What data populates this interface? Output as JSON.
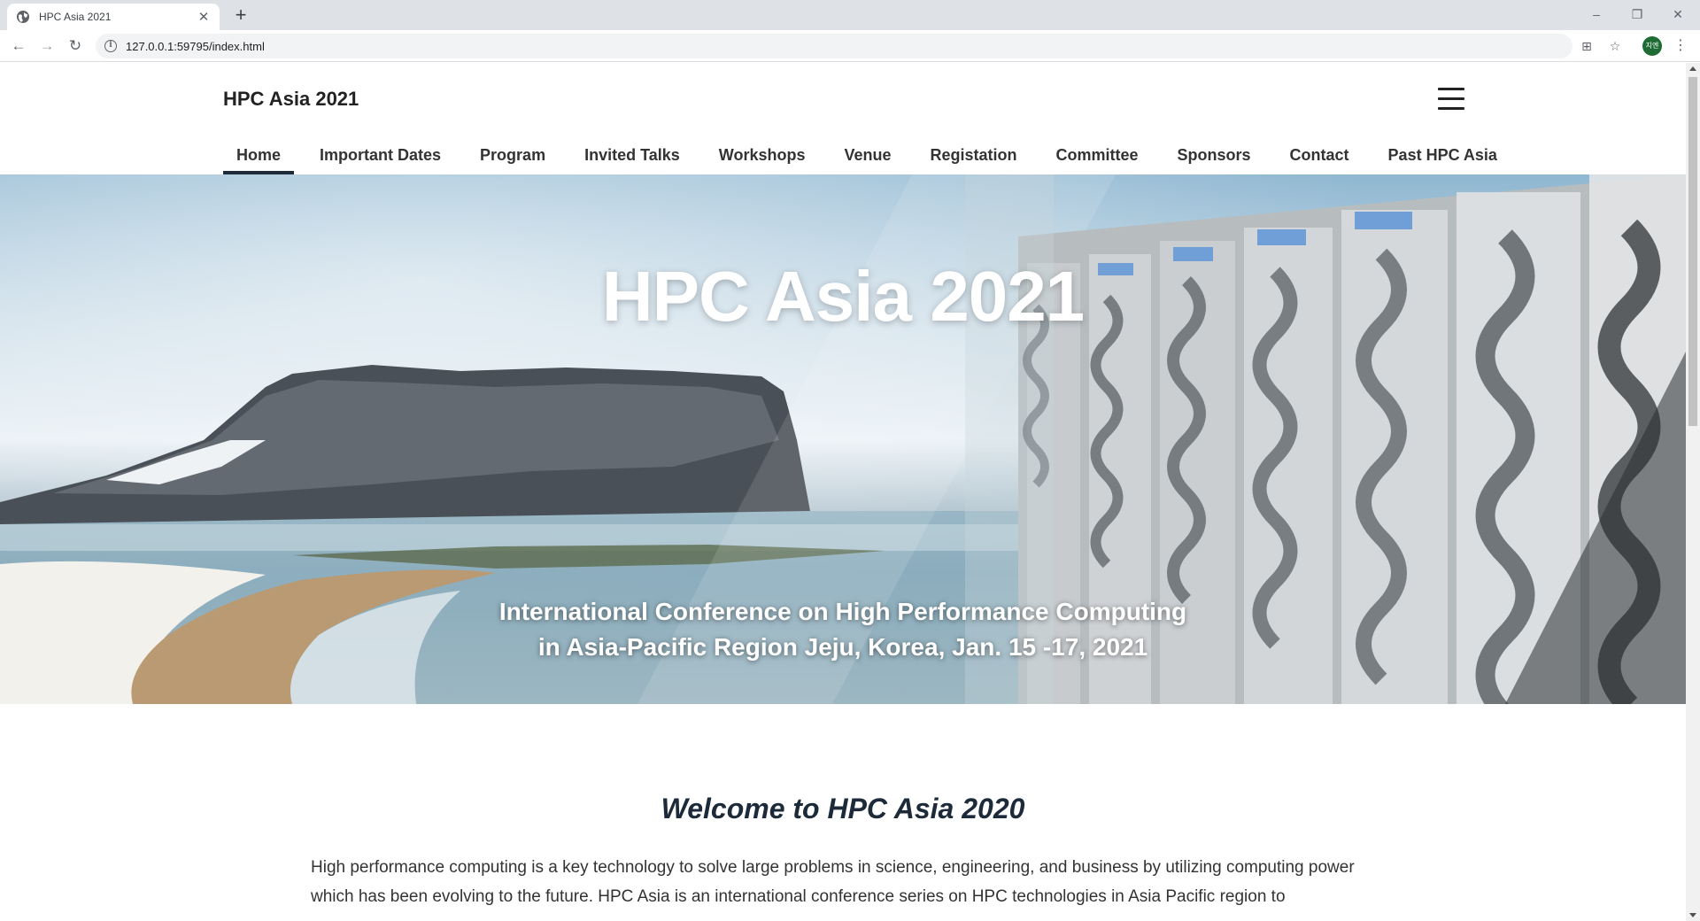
{
  "browser": {
    "tab_title": "HPC Asia 2021",
    "url": "127.0.0.1:59795/index.html",
    "avatar_text": "지엔"
  },
  "site": {
    "brand": "HPC Asia 2021",
    "nav": [
      {
        "label": "Home",
        "active": true
      },
      {
        "label": "Important Dates"
      },
      {
        "label": "Program"
      },
      {
        "label": "Invited Talks"
      },
      {
        "label": "Workshops"
      },
      {
        "label": "Venue"
      },
      {
        "label": "Registation"
      },
      {
        "label": "Committee"
      },
      {
        "label": "Sponsors"
      },
      {
        "label": "Contact"
      },
      {
        "label": "Past HPC Asia"
      }
    ]
  },
  "hero": {
    "title": "HPC Asia 2021",
    "subtitle_line1": "International Conference on High Performance Computing",
    "subtitle_line2": "in Asia-Pacific Region Jeju, Korea, Jan. 15 -17, 2021"
  },
  "content": {
    "welcome": "Welcome to HPC Asia 2020",
    "intro": "High performance computing is a key technology to solve large problems in science, engineering, and business by utilizing computing power which has been evolving to the future. HPC Asia is an international conference series on HPC technologies in Asia Pacific region to"
  },
  "colors": {
    "nav_underline": "#1c2a3a",
    "heading": "#1c2a3a"
  }
}
